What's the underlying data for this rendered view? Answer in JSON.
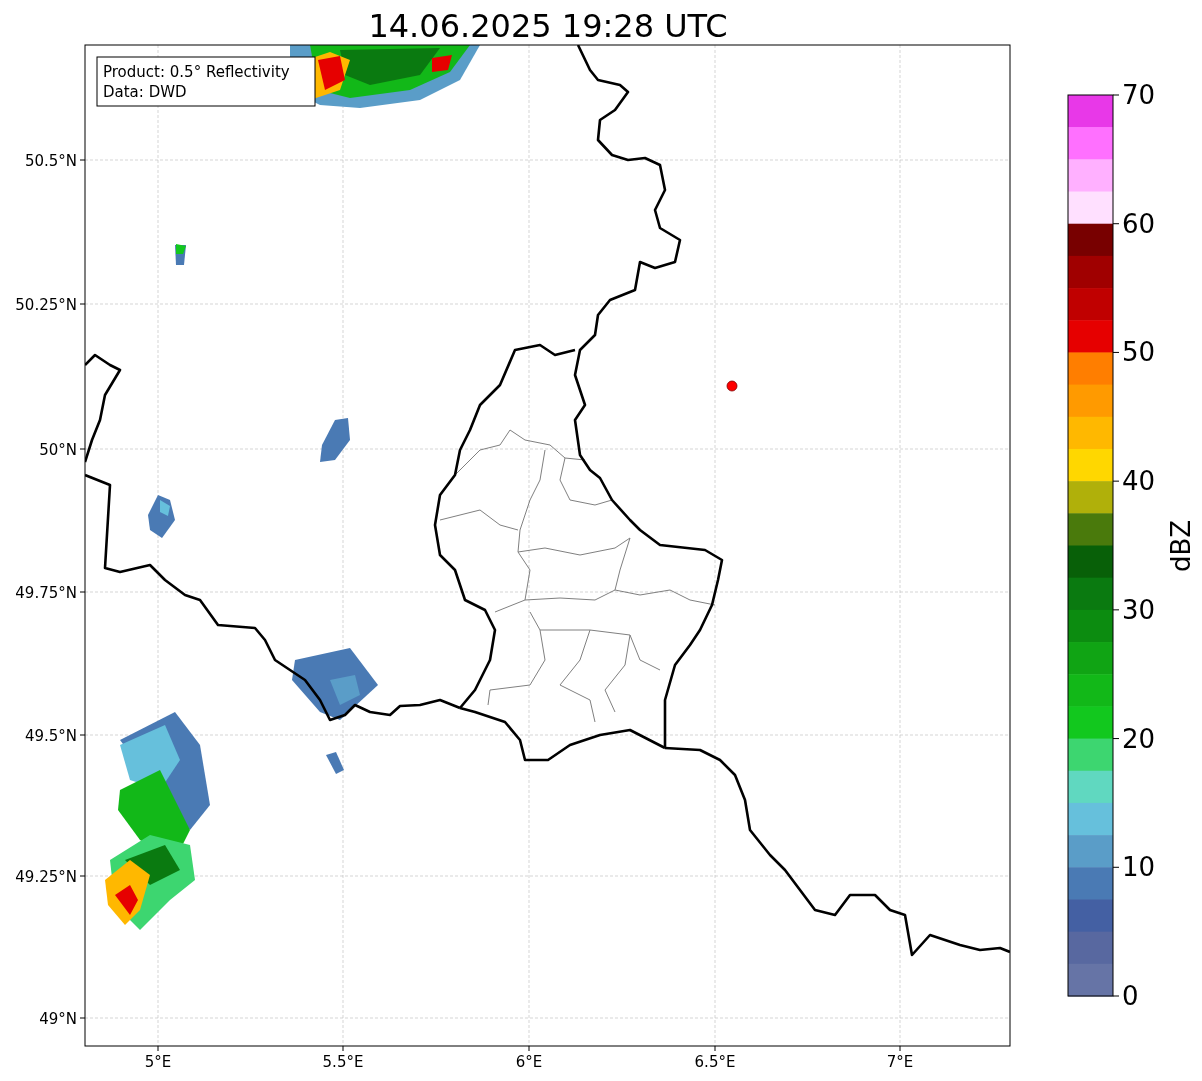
{
  "title": "14.06.2025 19:28 UTC",
  "info_box": [
    "Product: 0.5° Reflectivity",
    "Data: DWD"
  ],
  "y_axis": {
    "ticks": [
      "50.5°N",
      "50.25°N",
      "50°N",
      "49.75°N",
      "49.5°N",
      "49.25°N",
      "49°N"
    ]
  },
  "x_axis": {
    "ticks": [
      "5°E",
      "5.5°E",
      "6°E",
      "6.5°E",
      "7°E"
    ]
  },
  "colorbar": {
    "label": "dBZ",
    "bands": [
      {
        "color": "#e838e8"
      },
      {
        "color": "#ff70ff"
      },
      {
        "color": "#ffb0ff"
      },
      {
        "color": "#ffe0ff"
      },
      {
        "color": "#780000"
      },
      {
        "color": "#a00000"
      },
      {
        "color": "#c00000"
      },
      {
        "color": "#e60000"
      },
      {
        "color": "#ff7e00"
      },
      {
        "color": "#ff9a00"
      },
      {
        "color": "#ffb800"
      },
      {
        "color": "#ffd700"
      },
      {
        "color": "#b0b00a"
      },
      {
        "color": "#4a7a0c"
      },
      {
        "color": "#086008"
      },
      {
        "color": "#0a7a10"
      },
      {
        "color": "#0c8c10"
      },
      {
        "color": "#10a414"
      },
      {
        "color": "#12b818"
      },
      {
        "color": "#12c81e"
      },
      {
        "color": "#3dd670"
      },
      {
        "color": "#60d8c0"
      },
      {
        "color": "#66c0dc"
      },
      {
        "color": "#5a9dc8"
      },
      {
        "color": "#4a7ab4"
      },
      {
        "color": "#4460a3"
      },
      {
        "color": "#5868a0"
      },
      {
        "color": "#6674a6"
      }
    ],
    "ticks": [
      "70",
      "60",
      "50",
      "40",
      "30",
      "20",
      "10",
      "0"
    ]
  }
}
